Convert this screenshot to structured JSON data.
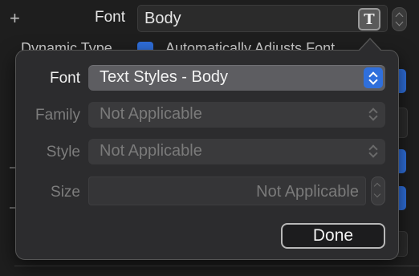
{
  "inspector": {
    "add_label": "+",
    "font_label": "Font",
    "font_value": "Body",
    "text_style_glyph": "T",
    "dynamic_type_label": "Dynamic Type",
    "auto_adjusts_label": "Automatically Adjusts Font"
  },
  "popover": {
    "font_label": "Font",
    "font_value": "Text Styles - Body",
    "family_label": "Family",
    "family_value": "Not Applicable",
    "style_label": "Style",
    "style_value": "Not Applicable",
    "size_label": "Size",
    "size_value": "Not Applicable",
    "done_label": "Done"
  },
  "colors": {
    "background": "#1e1e1e",
    "popover": "#2c2c2e",
    "accent": "#2f6fdc",
    "disabled_text": "#7a7a7a"
  }
}
